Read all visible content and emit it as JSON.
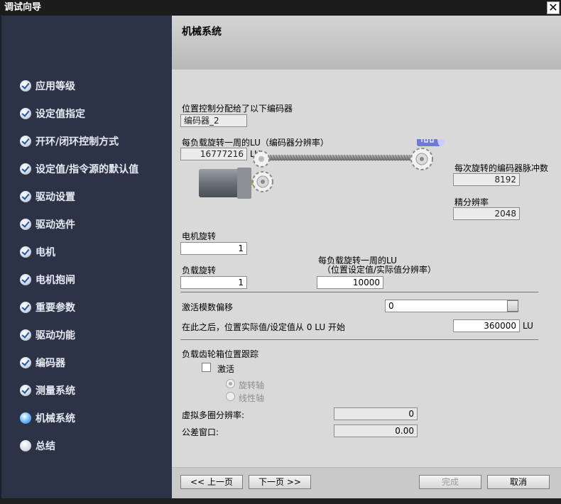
{
  "window": {
    "title": "调试向导",
    "close_symbol": "✕"
  },
  "sidebar": {
    "items": [
      {
        "label": "应用等级",
        "state": "done"
      },
      {
        "label": "设定值指定",
        "state": "done"
      },
      {
        "label": "开环/闭环控制方式",
        "state": "done"
      },
      {
        "label": "设定值/指令源的默认值",
        "state": "done"
      },
      {
        "label": "驱动设置",
        "state": "done"
      },
      {
        "label": "驱动选件",
        "state": "done"
      },
      {
        "label": "电机",
        "state": "done"
      },
      {
        "label": "电机抱闸",
        "state": "done"
      },
      {
        "label": "重要参数",
        "state": "done"
      },
      {
        "label": "驱动功能",
        "state": "done"
      },
      {
        "label": "编码器",
        "state": "done"
      },
      {
        "label": "测量系统",
        "state": "done"
      },
      {
        "label": "机械系统",
        "state": "active"
      },
      {
        "label": "总结",
        "state": "pending"
      }
    ]
  },
  "header": {
    "title": "机械系统"
  },
  "mechanics": {
    "encoder_assigned_label": "位置控制分配给了以下编码器",
    "encoder_name": "编码器_2",
    "lu_per_rev_label": "每负载旋转一周的LU（编码器分辨率）",
    "lu_per_rev_value": "16777216",
    "lu_unit": "LU",
    "encoder_pulses_label": "每次旋转的编码器脉冲数",
    "encoder_pulses_value": "8192",
    "fine_resolution_label": "精分辨率",
    "fine_resolution_value": "2048",
    "motor_rev_label": "电机旋转",
    "motor_rev_value": "1",
    "load_rev_label": "负载旋转",
    "load_rev_value": "1",
    "lu_per_load_rev_label_1": "每负载旋转一周的LU",
    "lu_per_load_rev_label_2": "（位置设定值/实际值分辨率）",
    "lu_per_load_rev_value": "10000"
  },
  "modulo": {
    "activate_label": "激活模数偏移",
    "activate_value": "0",
    "start_label": "在此之后，位置实际值/设定值从 0 LU 开始",
    "start_value": "360000",
    "start_unit": "LU"
  },
  "gearbox": {
    "section_label": "负载齿轮箱位置跟踪",
    "activate_label": "激活",
    "activate_checked": false,
    "rotary_axis_label": "旋转轴",
    "linear_axis_label": "线性轴",
    "virtual_multiturn_label": "虚拟多圈分辨率:",
    "virtual_multiturn_value": "0",
    "tolerance_label": "公差窗口:",
    "tolerance_value": "0.00"
  },
  "footer": {
    "prev_label": "<< 上一页",
    "next_label": "下一页 >>",
    "finish_label": "完成",
    "cancel_label": "取消"
  },
  "colors": {
    "sidebar_bg": "#2c3347",
    "titlebar_bg": "#1c1c1c",
    "content_bg": "#d9d9d9",
    "active_icon": "#1f6fd1"
  }
}
